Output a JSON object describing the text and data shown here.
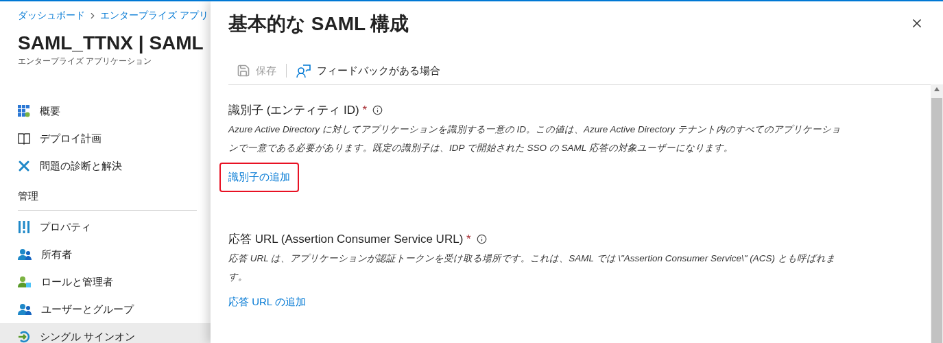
{
  "sidebar": {
    "breadcrumb": [
      "ダッシュボード",
      "エンタープライズ アプリ"
    ],
    "title": "SAML_TTNX | SAML",
    "subtitle": "エンタープライズ アプリケーション",
    "items": [
      {
        "kind": "grid",
        "label": "概要",
        "selected": false
      },
      {
        "kind": "book",
        "label": "デプロイ計画",
        "selected": false
      },
      {
        "kind": "tools",
        "label": "問題の診断と解決",
        "selected": false
      },
      {
        "kind": "header",
        "label": "管理"
      },
      {
        "kind": "bars",
        "label": "プロパティ",
        "selected": false
      },
      {
        "kind": "users",
        "label": "所有者",
        "selected": false
      },
      {
        "kind": "role",
        "label": "ロールと管理者",
        "selected": false
      },
      {
        "kind": "users",
        "label": "ユーザーとグループ",
        "selected": false
      },
      {
        "kind": "sso",
        "label": "シングル サインオン",
        "selected": true
      }
    ]
  },
  "panel": {
    "title": "基本的な SAML 構成",
    "toolbar": [
      {
        "kind": "save",
        "label": "保存",
        "disabled": true
      },
      {
        "kind": "feedback",
        "label": "フィードバックがある場合",
        "disabled": false
      }
    ],
    "sections": [
      {
        "label": "識別子 (エンティティ ID)",
        "required": "*",
        "description": "Azure Active Directory に対してアプリケーションを識別する一意の ID。この値は、Azure Active Directory テナント内のすべてのアプリケーションで一意である必要があります。既定の識別子は、IDP で開始された SSO の SAML 応答の対象ユーザーになります。",
        "link": "識別子の追加",
        "highlighted": true
      },
      {
        "label": "応答 URL (Assertion Consumer Service URL)",
        "required": "*",
        "description": "応答 URL は、アプリケーションが認証トークンを受け取る場所です。これは、SAML では \\\"Assertion Consumer Service\\\" (ACS) とも呼ばれます。",
        "link": "応答 URL の追加",
        "highlighted": false
      }
    ]
  }
}
